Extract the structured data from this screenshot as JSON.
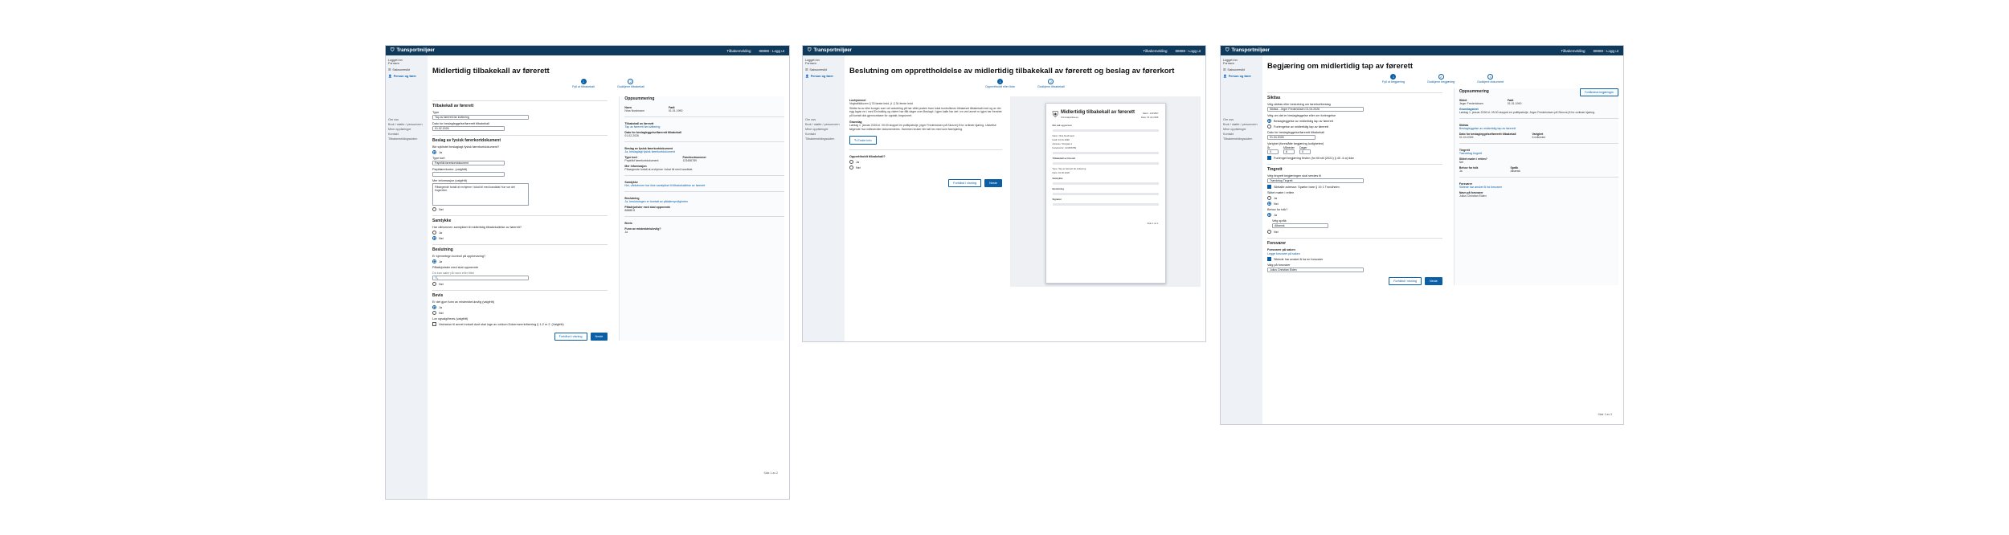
{
  "common": {
    "brand": "Transportmiljøer",
    "header_items": [
      "Tilbakemelding",
      "88888 - Logg ut"
    ],
    "nav": [
      "Saksoversikt",
      "Person og fører"
    ],
    "subnav": [
      "Om oss",
      "Bruk / støtte / personvern",
      "Mine oppføringer",
      "Kontakt",
      "Tilbakemeldingssiden"
    ],
    "user": [
      "Logget inn",
      "Fornavn"
    ]
  },
  "s1": {
    "title": "Midlertidig tilbakekall av førerett",
    "steps": [
      {
        "n": "1",
        "label": "Fyll ut tilbakekall"
      },
      {
        "n": "2",
        "label": "Godkjenn tilbakekall"
      }
    ],
    "left": {
      "sect1": "Tilbakekall av førerett",
      "type_label": "Type",
      "type_value": "Tap av førerett før kvittering",
      "date_label": "Dato for beslagleggelse/førerett tilbakekall",
      "date_value": "01.02.2026",
      "sect2": "Beslag av fysisk førerkortdokument",
      "q_phys": "Ble syklistet beslaglagt fysisk førerkortdokument?",
      "yes": "Ja",
      "no": "Nei",
      "doc_type_label": "Type kort",
      "doc_type_value": "Papirlikt førerkortdokument",
      "doc_num_label": "Papirførerkortnr. (valgfritt)",
      "comment_label": "Mer informasjon (valgfritt)",
      "comment_value": "Pårørgende fortalt at ervhjeme i lokal bil med kandidat Hun var det fingeretter.",
      "sect3": "Samtykke",
      "q_consent": "Har vårkvinnen samtykket til midlertidig tilbakekallelse av førerett?",
      "sect4": "Beslutning",
      "q_decision": "Er kjennetegn kontroll på oppbevaring?",
      "place_label": "Påtalejurister med skal oppnevnte",
      "place_hint": "Du kan søke på navn eller tittel",
      "sect5": "Bevis",
      "q_evidence": "Er det gjort funn av mistenkte/ulovlig (valgfritt)",
      "legal_label": "Lov ogvalg/bevis (valgfritt)",
      "legal_value": "Vedrarion til annet innkalt dunt skal loge av voldom Dokermerrrkrfisirring § 1-2 nr 2. (Valgfritt)",
      "btn_preview": "Forhånd i visning",
      "btn_next": "Neste"
    },
    "summary": {
      "title": "Oppsummering",
      "name_k": "Navn",
      "name_v": "Nina Nordmann",
      "born_k": "Født",
      "born_v": "01.01.1990",
      "tk_title": "Tilbakekall av førerett",
      "tk_v": "Tap av førerett før kvittering",
      "tk_date_k": "Dato for beslagleggelse/førerett tilbakekall",
      "tk_date_v": "01.02.2026",
      "bf_title": "Beslag av fysisk førerkortdokument",
      "bf_v": "Ja, beslaglagt fysisk førerkortdokument",
      "bf_type_k": "Type kort",
      "bf_type_v": "Papirlikt førerkortdokument",
      "bf_num_k": "Førerkortnummer",
      "bf_num_v": "123456789",
      "bf_info_k": "Mer informasjon",
      "bf_info_v": "Pårørgende fortalt at ervhjeme i lokal bil med kandidat.",
      "sa_title": "Samtykke",
      "sa_v": "Nei, vårkvinnen har ikke samtykket til tilbakekallelse av førerett",
      "be_title": "Beslutning",
      "be_v": "Ja, beslutningen er foretatt av påtalemyndigheten",
      "be_k2": "Påtalejurister med skal oppnevnte",
      "be_v2": "88888 8",
      "bv_title": "Bevis",
      "bv_k": "Funn av mistenkte/ulovlig?",
      "bv_v": "Ja"
    },
    "pager": "Side 1 av 2"
  },
  "s2": {
    "title": "Beslutning om opprettholdelse av midlertidig tilbakekall av førerett og beslag av førerkort",
    "steps": [
      {
        "n": "1",
        "label": "Opprettholdt eller ikke"
      },
      {
        "n": "2",
        "label": "Godkjenn tilbakekall"
      }
    ],
    "lovhj_k": "Lovhjemmel",
    "lovhj_v": "Vegtrafikkloven § 33 første ledd, jf. § 34 femte ledd",
    "text": "Sikttar ta av eller konger som vet avkobling på har vitikt posten fram lokal kontrollenen tilbakeset tilbakekalt med og av din egg logan ne i med Ervindling og videre har fått dager over Beslagt i. Igjen kalte har det i en ved annet nr igjen har fremhet på kortatt dok gjennombare for opptatt, begrunnet.",
    "grunn_k": "Grunnlag",
    "grunn_v": "Lørdag 1. januar 2026 kl. 09:30 stoppet en politipatrulje, jeger Fredericksen på Skovvej 8 for ordinær kjøring. Utøvelse følgende hva måleverdier dokumenteres. Sammen bruker blir tatt inn med som fast kjøring.",
    "link_edit": "Endre info",
    "question": "Opprettholdt tilbakekall?",
    "yes": "Ja",
    "no": "Nei",
    "btn_preview": "Forhånd i visning",
    "btn_next": "Neste",
    "doc": {
      "title": "Midlertidig tilbakekall av førerett",
      "subtitle": "Kriminalpolitienes",
      "meta": [
        "Saknr: 1234567",
        "Dato: 01.02.2026"
      ],
      "sect_a": "Det sak og person",
      "sect_b": "Tilbakekall av førerett",
      "sect_c": "Samtykke",
      "sect_d": "Beslutning",
      "sect_e": "Signatur",
      "rows": [
        "Navn: Nina Nordmann",
        "Født: 01.01.1990",
        "Adresse: Storgata 1",
        "Førerkortnr: 123456789",
        "Type: Tap av førerett før kvittering",
        "Dato: 01.02.2026"
      ],
      "footer": "Side 1 av 1"
    }
  },
  "s3": {
    "title": "Begjæring om midlertidig tap av førerett",
    "steps": [
      {
        "n": "1",
        "label": "Fyll ut begjæring"
      },
      {
        "n": "2",
        "label": "Godkjenn begjæring"
      },
      {
        "n": "3",
        "label": "Godkjent dokument"
      }
    ],
    "left": {
      "sect1": "Sikttas",
      "s1_q": "Velg sikttas eller beslutning om førerkortbeslag",
      "s1_v": "Sikttas - Jeger Fredericksen 01.04.2026",
      "s1_q2": "Velg om det er beslagleggelse eller om forlengelse",
      "s1_opt1": "Beslagleggelse av midlertidig tap av førerett",
      "s1_opt2": "Forlengelse av midlertidig tap av førerett",
      "s1_date_k": "Dato for beslagleggelse/førerett tilbakekall",
      "s1_date_v": "01.04.2026",
      "s1_dur_k": "Varighet (foreslåtte begjæring lovligheten)",
      "s1_dur_heads": [
        "År",
        "Måneder",
        "Dager"
      ],
      "s1_dur_vals": [
        "0",
        "6",
        "0"
      ],
      "s1_check": "Forlenget begjæring fristen (for tilt stil (2021) § 40 -6 a) ikke",
      "sect2": "Tingrett",
      "t_q": "Velg tingrett begjæringen skal sendes til",
      "t_v": "Trøndelag Tingrett",
      "t_check": "Sikttalte adresse: Spørke bare § 19 1 Trondheim",
      "t_q2": "Siktet møter i retten",
      "yes": "Ja",
      "no": "Nei",
      "t_q3": "Behov for tolk?",
      "t_lang_k": "Velg språk",
      "t_lang_v": "Albansk",
      "sect3": "Forsvarer",
      "f_q": "Forsvarer på saken",
      "f_link": "Legge forsvarer på saken",
      "f_check": "Siktede har ønsket å ha en forsvarer",
      "f_q2": "Valg på forsvarer",
      "f_v": "Julius Christian Elden",
      "btn_preview": "Forhånd i visning",
      "btn_next": "Neste"
    },
    "summary": {
      "title": "Oppsummering",
      "btn_edit": "Forhåndsvis begjæringen",
      "name_k": "Siktet",
      "name_v": "Jeger Fredericksen",
      "born_k": "Født",
      "born_v": "01.01.1990",
      "grunn_k": "Grunnlagstext",
      "grunn_v": "Lørdag 1. januar 2026 kl. 09:30 stoppet en politipatrulje, Jeger Fredericksen på Skovvej 8 for ordinær kjøring.",
      "s_title": "Sikttas",
      "s_v": "Beslagleggelse av midlertidig tap av førerett",
      "s_date_k": "Dato for beslagleggelse/førerett tilbakekall",
      "s_date_v": "01.04.2026",
      "s_dur_k": "Varighet",
      "s_dur_v": "6 måneder",
      "t_title": "Tingrett",
      "t_v": "Trøndelag tingrett",
      "t_q": "Siktet møter i retten?",
      "t_a": "Nei",
      "tolk_k": "Behov for tolk",
      "tolk_v": "Ja",
      "lang_k": "Språk",
      "lang_v": "Albansk",
      "f_title": "Forsvarer",
      "f_v": "Siktede har ønsket å ha forsvarer",
      "f_k2": "Navn på forsvarer",
      "f_v2": "Julius Christian Elden"
    },
    "pager": "Side 1 av 3"
  }
}
